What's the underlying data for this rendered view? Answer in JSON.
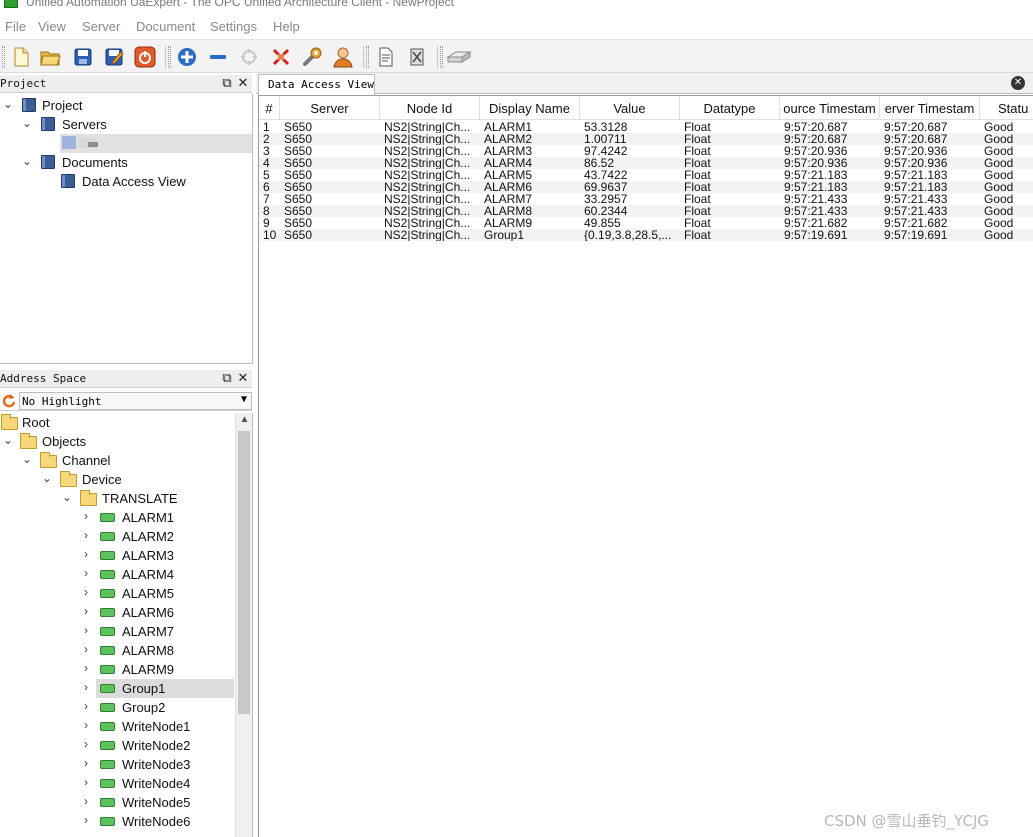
{
  "window": {
    "title": "Unified Automation UaExpert - The OPC Unified Architecture Client - NewProject"
  },
  "menu": {
    "items": [
      "File",
      "View",
      "Server",
      "Document",
      "Settings",
      "Help"
    ]
  },
  "toolbar": {
    "buttons": [
      "new-document-icon",
      "open-folder-icon",
      "save-icon",
      "save-as-icon",
      "power-icon",
      "add-server-icon",
      "remove-server-icon",
      "connect-icon",
      "disconnect-icon",
      "settings-icon",
      "user-icon",
      "document-icon",
      "delete-icon",
      "device-icon"
    ]
  },
  "project_panel": {
    "title": "Project",
    "items": {
      "project": "Project",
      "servers": "Servers",
      "documents": "Documents",
      "data_access_view": "Data Access View"
    }
  },
  "address_panel": {
    "title": "Address Space",
    "highlight_select": "No Highlight",
    "tree": {
      "root": "Root",
      "objects": "Objects",
      "channel": "Channel",
      "device": "Device",
      "translate": "TRANSLATE",
      "nodes": [
        "ALARM1",
        "ALARM2",
        "ALARM3",
        "ALARM4",
        "ALARM5",
        "ALARM6",
        "ALARM7",
        "ALARM8",
        "ALARM9",
        "Group1",
        "Group2",
        "WriteNode1",
        "WriteNode2",
        "WriteNode3",
        "WriteNode4",
        "WriteNode5",
        "WriteNode6"
      ],
      "selected": "Group1"
    }
  },
  "data_access_view": {
    "tab_label": "Data Access View",
    "columns": [
      "#",
      "Server",
      "Node Id",
      "Display Name",
      "Value",
      "Datatype",
      "ource Timestam",
      "erver Timestam",
      "Statu"
    ],
    "rows": [
      [
        "1",
        "S650",
        "NS2|String|Ch...",
        "ALARM1",
        "53.3128",
        "Float",
        "9:57:20.687",
        "9:57:20.687",
        "Good"
      ],
      [
        "2",
        "S650",
        "NS2|String|Ch...",
        "ALARM2",
        "1.00711",
        "Float",
        "9:57:20.687",
        "9:57:20.687",
        "Good"
      ],
      [
        "3",
        "S650",
        "NS2|String|Ch...",
        "ALARM3",
        "97.4242",
        "Float",
        "9:57:20.936",
        "9:57:20.936",
        "Good"
      ],
      [
        "4",
        "S650",
        "NS2|String|Ch...",
        "ALARM4",
        "86.52",
        "Float",
        "9:57:20.936",
        "9:57:20.936",
        "Good"
      ],
      [
        "5",
        "S650",
        "NS2|String|Ch...",
        "ALARM5",
        "43.7422",
        "Float",
        "9:57:21.183",
        "9:57:21.183",
        "Good"
      ],
      [
        "6",
        "S650",
        "NS2|String|Ch...",
        "ALARM6",
        "69.9637",
        "Float",
        "9:57:21.183",
        "9:57:21.183",
        "Good"
      ],
      [
        "7",
        "S650",
        "NS2|String|Ch...",
        "ALARM7",
        "33.2957",
        "Float",
        "9:57:21.433",
        "9:57:21.433",
        "Good"
      ],
      [
        "8",
        "S650",
        "NS2|String|Ch...",
        "ALARM8",
        "60.2344",
        "Float",
        "9:57:21.433",
        "9:57:21.433",
        "Good"
      ],
      [
        "9",
        "S650",
        "NS2|String|Ch...",
        "ALARM9",
        "49.855",
        "Float",
        "9:57:21.682",
        "9:57:21.682",
        "Good"
      ],
      [
        "10",
        "S650",
        "NS2|String|Ch...",
        "Group1",
        "{0.19,3.8,28.5,...",
        "Float",
        "9:57:19.691",
        "9:57:19.691",
        "Good"
      ]
    ]
  },
  "watermark": "CSDN @雪山垂钓_YCJG"
}
